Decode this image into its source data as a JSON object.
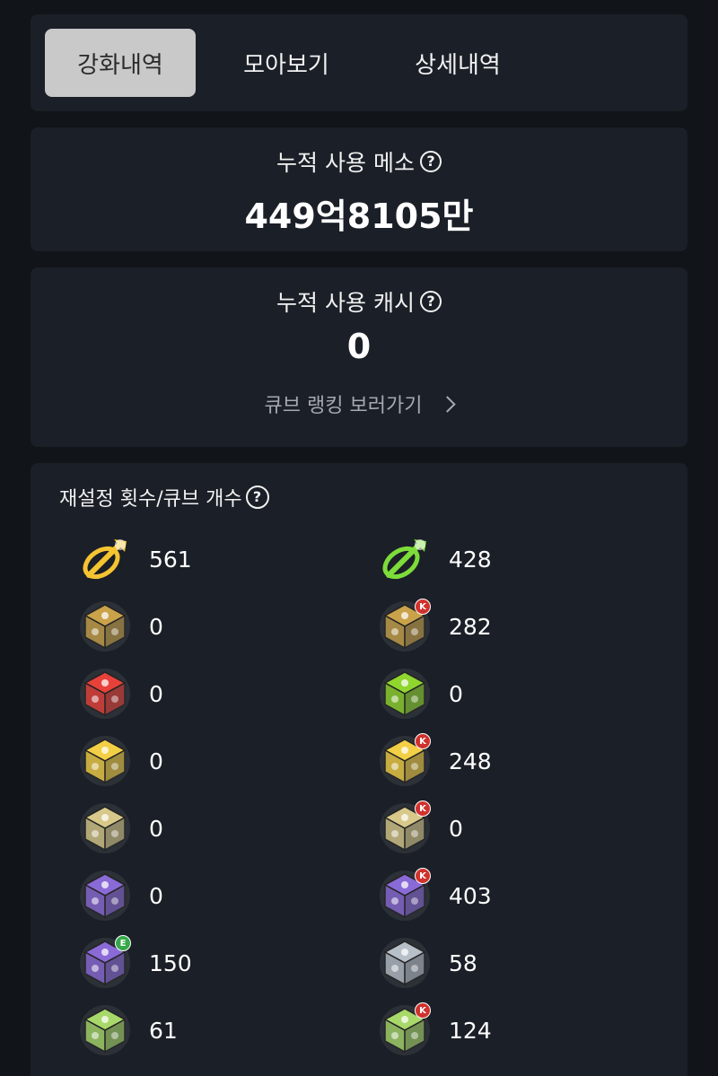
{
  "tabs": [
    {
      "label": "강화내역",
      "active": true
    },
    {
      "label": "모아보기",
      "active": false
    },
    {
      "label": "상세내역",
      "active": false
    }
  ],
  "meso": {
    "label": "누적 사용 메소",
    "value": "449억8105만"
  },
  "cash": {
    "label": "누적 사용 캐시",
    "value": "0",
    "ranking_link": "큐브 랭킹 보러가기"
  },
  "cubes": {
    "title": "재설정 횟수/큐브 개수",
    "items": [
      {
        "icon": "gold-hammer-icon",
        "count": "561",
        "color": "#f5c431",
        "shape": "hammer",
        "badge": ""
      },
      {
        "icon": "green-hammer-icon",
        "count": "428",
        "color": "#7ddc3a",
        "shape": "hammer",
        "badge": ""
      },
      {
        "icon": "black-cube-icon",
        "count": "0",
        "color": "#c9a24a",
        "shape": "cube",
        "badge": ""
      },
      {
        "icon": "black-cube-k-icon",
        "count": "282",
        "color": "#c9a24a",
        "shape": "cube",
        "badge": "K"
      },
      {
        "icon": "red-cube-icon",
        "count": "0",
        "color": "#e8413a",
        "shape": "cube",
        "badge": ""
      },
      {
        "icon": "additional-cube-icon",
        "count": "0",
        "color": "#8fd62e",
        "shape": "cube",
        "badge": ""
      },
      {
        "icon": "master-cube-icon",
        "count": "0",
        "color": "#f2cf45",
        "shape": "cube",
        "badge": ""
      },
      {
        "icon": "master-cube-k-icon",
        "count": "248",
        "color": "#f2cf45",
        "shape": "cube",
        "badge": "K"
      },
      {
        "icon": "meister-cube-icon",
        "count": "0",
        "color": "#d8c98a",
        "shape": "cube",
        "badge": ""
      },
      {
        "icon": "meister-cube-k-icon",
        "count": "0",
        "color": "#d8c98a",
        "shape": "cube",
        "badge": "K"
      },
      {
        "icon": "occult-cube-icon",
        "count": "0",
        "color": "#8a6ad6",
        "shape": "cube",
        "badge": ""
      },
      {
        "icon": "occult-cube-k-icon",
        "count": "403",
        "color": "#8a6ad6",
        "shape": "cube",
        "badge": "K"
      },
      {
        "icon": "occult-cube-e-icon",
        "count": "150",
        "color": "#8a6ad6",
        "shape": "cube",
        "badge": "E"
      },
      {
        "icon": "artisan-cube-icon",
        "count": "58",
        "color": "#b7bfc9",
        "shape": "cube",
        "badge": ""
      },
      {
        "icon": "glowing-cube-icon",
        "count": "61",
        "color": "#a8d86a",
        "shape": "cube",
        "badge": ""
      },
      {
        "icon": "glowing-cube-k-icon",
        "count": "124",
        "color": "#a8d86a",
        "shape": "cube",
        "badge": "K"
      }
    ]
  },
  "colors": {
    "background": "#111418",
    "card": "#1b1f27",
    "tab_active": "#c9c9c9",
    "badge_k": "#d0322d",
    "badge_e": "#37a84a"
  }
}
